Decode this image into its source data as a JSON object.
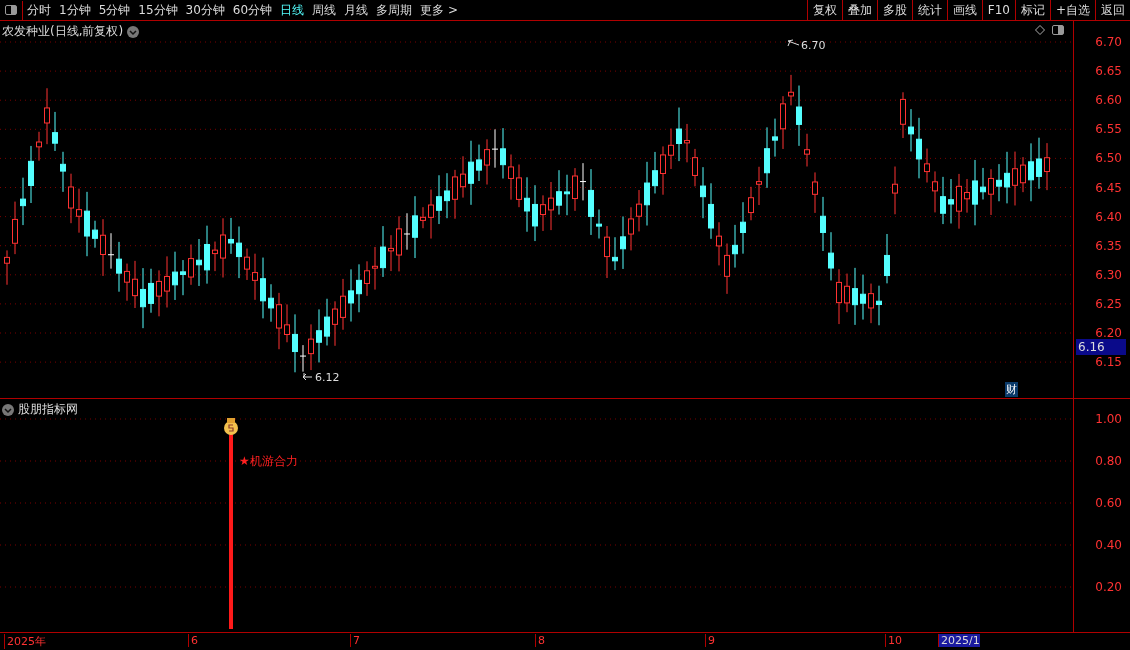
{
  "toolbar": {
    "periods": [
      {
        "label": "分时",
        "selected": false
      },
      {
        "label": "1分钟",
        "selected": false
      },
      {
        "label": "5分钟",
        "selected": false
      },
      {
        "label": "15分钟",
        "selected": false
      },
      {
        "label": "30分钟",
        "selected": false
      },
      {
        "label": "60分钟",
        "selected": false
      },
      {
        "label": "日线",
        "selected": true
      },
      {
        "label": "周线",
        "selected": false
      },
      {
        "label": "月线",
        "selected": false
      },
      {
        "label": "多周期",
        "selected": false
      },
      {
        "label": "更多 >",
        "selected": false
      }
    ],
    "buttons": [
      "复权",
      "叠加",
      "多股",
      "统计",
      "画线",
      "F10",
      "标记",
      "+自选",
      "返回"
    ]
  },
  "price_chart": {
    "title": "农发种业(日线,前复权)",
    "high_label": "6.70",
    "low_label": "6.12",
    "current_price": "6.16",
    "badge": "财",
    "yticks": [
      "6.70",
      "6.65",
      "6.60",
      "6.55",
      "6.50",
      "6.45",
      "6.40",
      "6.35",
      "6.30",
      "6.25",
      "6.20",
      "6.15"
    ]
  },
  "indicator": {
    "title": "股朋指标网",
    "signal_label": "★机游合力",
    "yticks": [
      "1.00",
      "0.80",
      "0.60",
      "0.40",
      "0.20"
    ]
  },
  "date_axis": [
    {
      "label": "2025年",
      "selected": false
    },
    {
      "label": "6",
      "selected": false
    },
    {
      "label": "7",
      "selected": false
    },
    {
      "label": "8",
      "selected": false
    },
    {
      "label": "9",
      "selected": false
    },
    {
      "label": "10",
      "selected": false
    },
    {
      "label": "2025/1",
      "selected": true
    }
  ]
}
